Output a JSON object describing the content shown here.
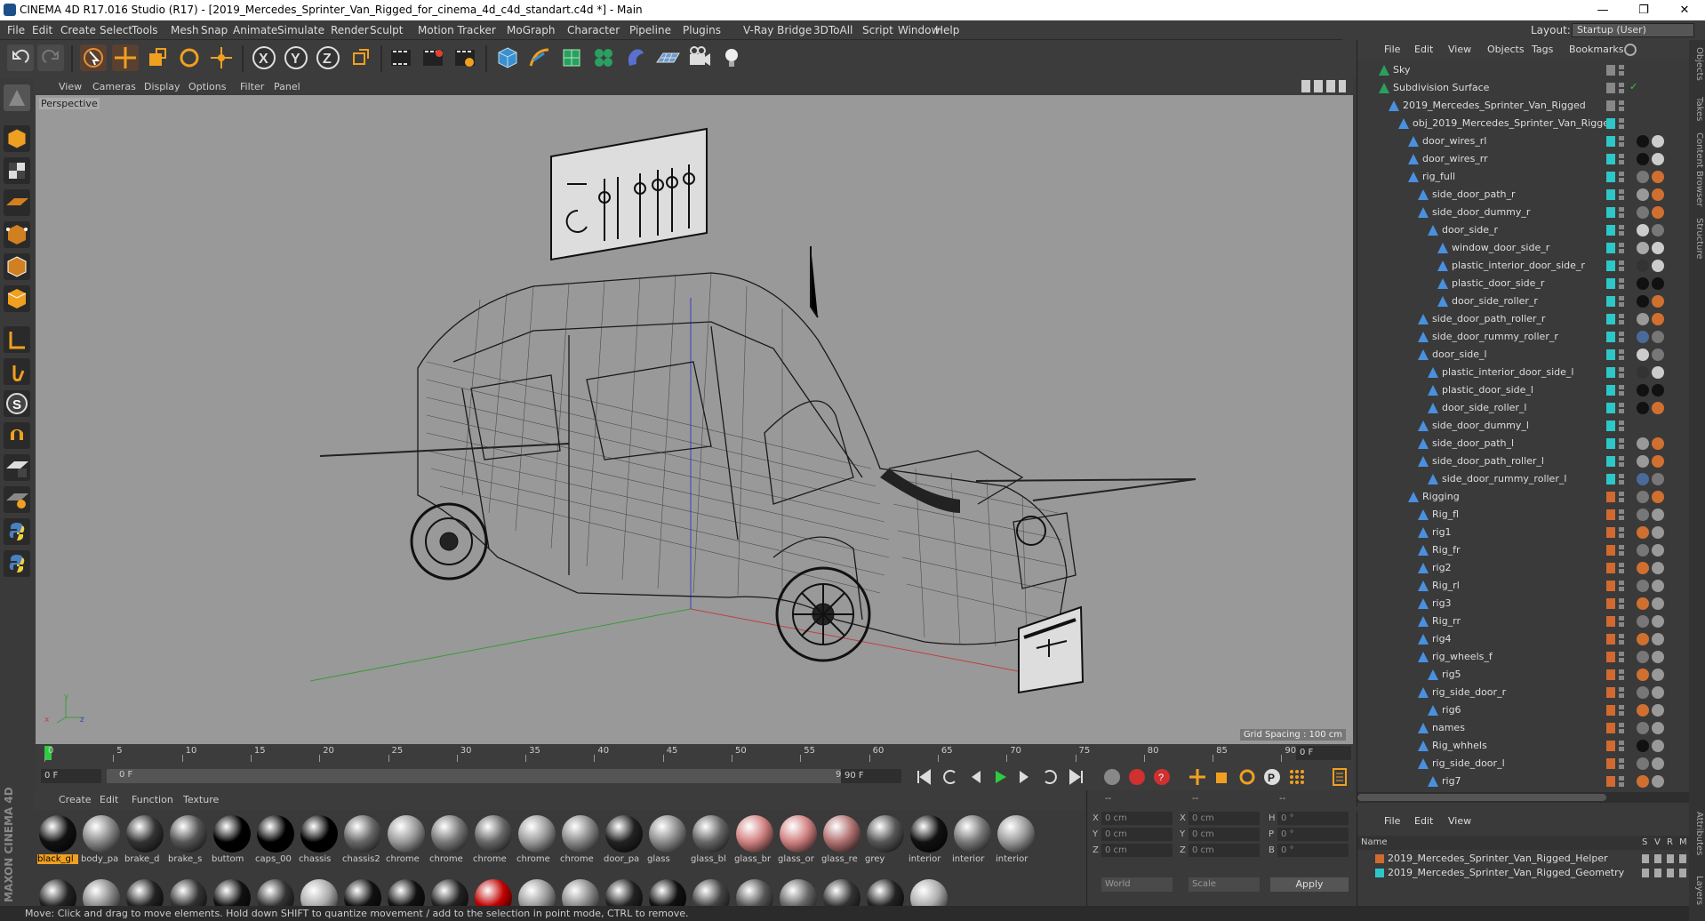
{
  "window": {
    "title": "CINEMA 4D R17.016 Studio (R17) - [2019_Mercedes_Sprinter_Van_Rigged_for_cinema_4d_c4d_standart.c4d *] - Main",
    "minimize": "—",
    "maximize": "❐",
    "close": "✕"
  },
  "menu": [
    "File",
    "Edit",
    "Create",
    "Select",
    "Tools",
    "Mesh",
    "Snap",
    "Animate",
    "Simulate",
    "Render",
    "Sculpt",
    "Motion Tracker",
    "MoGraph",
    "Character",
    "Pipeline",
    "Plugins",
    "V-Ray Bridge",
    "3DToAll",
    "Script",
    "Window",
    "Help"
  ],
  "layout": {
    "label": "Layout:",
    "value": "Startup (User)"
  },
  "viewport": {
    "menu": [
      "View",
      "Cameras",
      "Display",
      "Options",
      "Filter",
      "Panel"
    ],
    "label": "Perspective",
    "grid_spacing": "Grid Spacing : 100 cm",
    "axis_y": "y",
    "axis_x": "x",
    "axis_z": "z"
  },
  "timeline": {
    "ticks": [
      "0",
      "5",
      "10",
      "15",
      "20",
      "25",
      "30",
      "35",
      "40",
      "45",
      "50",
      "55",
      "60",
      "65",
      "70",
      "75",
      "80",
      "85",
      "90"
    ],
    "current_frame": "0 F"
  },
  "transport": {
    "start": "0 F",
    "range_start": "0 F",
    "range_end": "90 F",
    "end": "90 F"
  },
  "material_menu": [
    "Create",
    "Edit",
    "Function",
    "Texture"
  ],
  "materials": [
    {
      "name": "black_gl",
      "color": "#111"
    },
    {
      "name": "body_pa",
      "color": "#888"
    },
    {
      "name": "brake_d",
      "color": "#333"
    },
    {
      "name": "brake_s",
      "color": "#555"
    },
    {
      "name": "buttom",
      "color": "#000"
    },
    {
      "name": "caps_00",
      "color": "#000"
    },
    {
      "name": "chassis",
      "color": "#000"
    },
    {
      "name": "chassis2",
      "color": "#666"
    },
    {
      "name": "chrome",
      "color": "#999"
    },
    {
      "name": "chrome",
      "color": "#777"
    },
    {
      "name": "chrome",
      "color": "#666"
    },
    {
      "name": "chrome",
      "color": "#999"
    },
    {
      "name": "chrome",
      "color": "#888"
    },
    {
      "name": "door_pa",
      "color": "#222"
    },
    {
      "name": "glass",
      "color": "#8a8a8a"
    },
    {
      "name": "glass_bl",
      "color": "#666"
    },
    {
      "name": "glass_br",
      "color": "#d08080"
    },
    {
      "name": "glass_or",
      "color": "#d08080"
    },
    {
      "name": "glass_re",
      "color": "#b07070"
    },
    {
      "name": "grey",
      "color": "#555"
    },
    {
      "name": "interior",
      "color": "#111"
    },
    {
      "name": "interior",
      "color": "#777"
    },
    {
      "name": "interior",
      "color": "#999"
    }
  ],
  "materials_row2": [
    "#222",
    "#888",
    "#222",
    "#333",
    "#111",
    "#333",
    "#aaa",
    "#111",
    "#111",
    "#222",
    "#c00000",
    "#999",
    "#888",
    "#222",
    "#111",
    "#444",
    "#555",
    "#666",
    "#333",
    "#222",
    "#aaa"
  ],
  "coords": {
    "headers": [
      "--",
      "--",
      "--"
    ],
    "rows": [
      {
        "axis": "X",
        "pos": "0 cm",
        "size_axis": "X",
        "size": "0 cm",
        "rot_axis": "H",
        "rot": "0 °"
      },
      {
        "axis": "Y",
        "pos": "0 cm",
        "size_axis": "Y",
        "size": "0 cm",
        "rot_axis": "P",
        "rot": "0 °"
      },
      {
        "axis": "Z",
        "pos": "0 cm",
        "size_axis": "Z",
        "size": "0 cm",
        "rot_axis": "B",
        "rot": "0 °"
      }
    ],
    "mode": "World",
    "transform": "Scale",
    "apply": "Apply"
  },
  "status": "Move: Click and drag to move elements. Hold down SHIFT to quantize movement / add to the selection in point mode, CTRL to remove.",
  "maxon": "MAXON CINEMA 4D",
  "object_menu": [
    "File",
    "Edit",
    "View",
    "Objects",
    "Tags",
    "Bookmarks"
  ],
  "objects": [
    {
      "name": "Sky",
      "depth": 0,
      "lay": "#888",
      "tags": []
    },
    {
      "name": "Subdivision Surface",
      "depth": 0,
      "lay": "#888",
      "tags": [],
      "check": "✓"
    },
    {
      "name": "2019_Mercedes_Sprinter_Van_Rigged",
      "depth": 1,
      "lay": "#888",
      "tags": []
    },
    {
      "name": "obj_2019_Mercedes_Sprinter_Van_Rigged",
      "depth": 2,
      "lay": "#2ec7c7",
      "tags": []
    },
    {
      "name": "door_wires_rl",
      "depth": 3,
      "lay": "#2ec7c7",
      "tags": [
        "#111",
        "#ccc"
      ]
    },
    {
      "name": "door_wires_rr",
      "depth": 3,
      "lay": "#2ec7c7",
      "tags": [
        "#111",
        "#ccc"
      ]
    },
    {
      "name": "rig_full",
      "depth": 3,
      "lay": "#2ec7c7",
      "tags": [
        "#777",
        "#d07030"
      ]
    },
    {
      "name": "side_door_path_r",
      "depth": 4,
      "lay": "#2ec7c7",
      "tags": [
        "#999",
        "#d07030"
      ]
    },
    {
      "name": "side_door_dummy_r",
      "depth": 4,
      "lay": "#2ec7c7",
      "tags": [
        "#777",
        "#d07030"
      ]
    },
    {
      "name": "door_side_r",
      "depth": 5,
      "lay": "#2ec7c7",
      "tags": [
        "#ccc",
        "#777"
      ]
    },
    {
      "name": "window_door_side_r",
      "depth": 6,
      "lay": "#2ec7c7",
      "tags": [
        "#aaa",
        "#ccc"
      ]
    },
    {
      "name": "plastic_interior_door_side_r",
      "depth": 6,
      "lay": "#2ec7c7",
      "tags": [
        "#333",
        "#ccc"
      ]
    },
    {
      "name": "plastic_door_side_r",
      "depth": 6,
      "lay": "#2ec7c7",
      "tags": [
        "#111",
        "#111"
      ]
    },
    {
      "name": "door_side_roller_r",
      "depth": 6,
      "lay": "#2ec7c7",
      "tags": [
        "#111",
        "#d07030"
      ]
    },
    {
      "name": "side_door_path_roller_r",
      "depth": 4,
      "lay": "#2ec7c7",
      "tags": [
        "#999",
        "#d07030"
      ]
    },
    {
      "name": "side_door_rummy_roller_r",
      "depth": 4,
      "lay": "#2ec7c7",
      "tags": [
        "#4a6a9a",
        "#777"
      ]
    },
    {
      "name": "door_side_l",
      "depth": 4,
      "lay": "#2ec7c7",
      "tags": [
        "#ccc",
        "#777"
      ]
    },
    {
      "name": "plastic_interior_door_side_l",
      "depth": 5,
      "lay": "#2ec7c7",
      "tags": [
        "#333",
        "#ccc"
      ]
    },
    {
      "name": "plastic_door_side_l",
      "depth": 5,
      "lay": "#2ec7c7",
      "tags": [
        "#111",
        "#111"
      ]
    },
    {
      "name": "door_side_roller_l",
      "depth": 5,
      "lay": "#2ec7c7",
      "tags": [
        "#111",
        "#d07030"
      ]
    },
    {
      "name": "side_door_dummy_l",
      "depth": 4,
      "lay": "#2ec7c7",
      "tags": []
    },
    {
      "name": "side_door_path_l",
      "depth": 4,
      "lay": "#2ec7c7",
      "tags": [
        "#999",
        "#d07030"
      ]
    },
    {
      "name": "side_door_path_roller_l",
      "depth": 4,
      "lay": "#2ec7c7",
      "tags": [
        "#999",
        "#d07030"
      ]
    },
    {
      "name": "side_door_rummy_roller_l",
      "depth": 5,
      "lay": "#2ec7c7",
      "tags": [
        "#4a6a9a",
        "#777"
      ]
    },
    {
      "name": "Rigging",
      "depth": 3,
      "lay": "#d06a30",
      "tags": [
        "#777",
        "#d07030"
      ]
    },
    {
      "name": "Rig_fl",
      "depth": 4,
      "lay": "#d06a30",
      "tags": [
        "#777",
        "#999"
      ]
    },
    {
      "name": "rig1",
      "depth": 4,
      "lay": "#d06a30",
      "tags": [
        "#d07030",
        "#999"
      ]
    },
    {
      "name": "Rig_fr",
      "depth": 4,
      "lay": "#d06a30",
      "tags": [
        "#777",
        "#999"
      ]
    },
    {
      "name": "rig2",
      "depth": 4,
      "lay": "#d06a30",
      "tags": [
        "#d07030",
        "#999"
      ]
    },
    {
      "name": "Rig_rl",
      "depth": 4,
      "lay": "#d06a30",
      "tags": [
        "#777",
        "#999"
      ]
    },
    {
      "name": "rig3",
      "depth": 4,
      "lay": "#d06a30",
      "tags": [
        "#d07030",
        "#999"
      ]
    },
    {
      "name": "Rig_rr",
      "depth": 4,
      "lay": "#d06a30",
      "tags": [
        "#777",
        "#999"
      ]
    },
    {
      "name": "rig4",
      "depth": 4,
      "lay": "#d06a30",
      "tags": [
        "#d07030",
        "#999"
      ]
    },
    {
      "name": "rig_wheels_f",
      "depth": 4,
      "lay": "#d06a30",
      "tags": [
        "#777",
        "#999"
      ]
    },
    {
      "name": "rig5",
      "depth": 5,
      "lay": "#d06a30",
      "tags": [
        "#d07030",
        "#999"
      ]
    },
    {
      "name": "rig_side_door_r",
      "depth": 4,
      "lay": "#d06a30",
      "tags": [
        "#777",
        "#999"
      ]
    },
    {
      "name": "rig6",
      "depth": 5,
      "lay": "#d06a30",
      "tags": [
        "#d07030",
        "#999"
      ]
    },
    {
      "name": "names",
      "depth": 4,
      "lay": "#d06a30",
      "tags": [
        "#777",
        "#999"
      ]
    },
    {
      "name": "Rig_whhels",
      "depth": 4,
      "lay": "#d06a30",
      "tags": [
        "#111",
        "#999"
      ]
    },
    {
      "name": "rig_side_door_l",
      "depth": 4,
      "lay": "#d06a30",
      "tags": [
        "#777",
        "#999"
      ]
    },
    {
      "name": "rig7",
      "depth": 5,
      "lay": "#d06a30",
      "tags": [
        "#d07030",
        "#999"
      ]
    }
  ],
  "layer_menu": [
    "File",
    "Edit",
    "View"
  ],
  "layer_header": {
    "name": "Name",
    "s": "S",
    "v": "V",
    "r": "R",
    "m": "M"
  },
  "layers": [
    {
      "name": "2019_Mercedes_Sprinter_Van_Rigged_Helper",
      "color": "#d06a30"
    },
    {
      "name": "2019_Mercedes_Sprinter_Van_Rigged_Geometry",
      "color": "#2ec7c7"
    }
  ],
  "side_tabs": [
    "Objects",
    "Takes",
    "Content Browser",
    "Structure",
    "Attributes",
    "Layers"
  ]
}
